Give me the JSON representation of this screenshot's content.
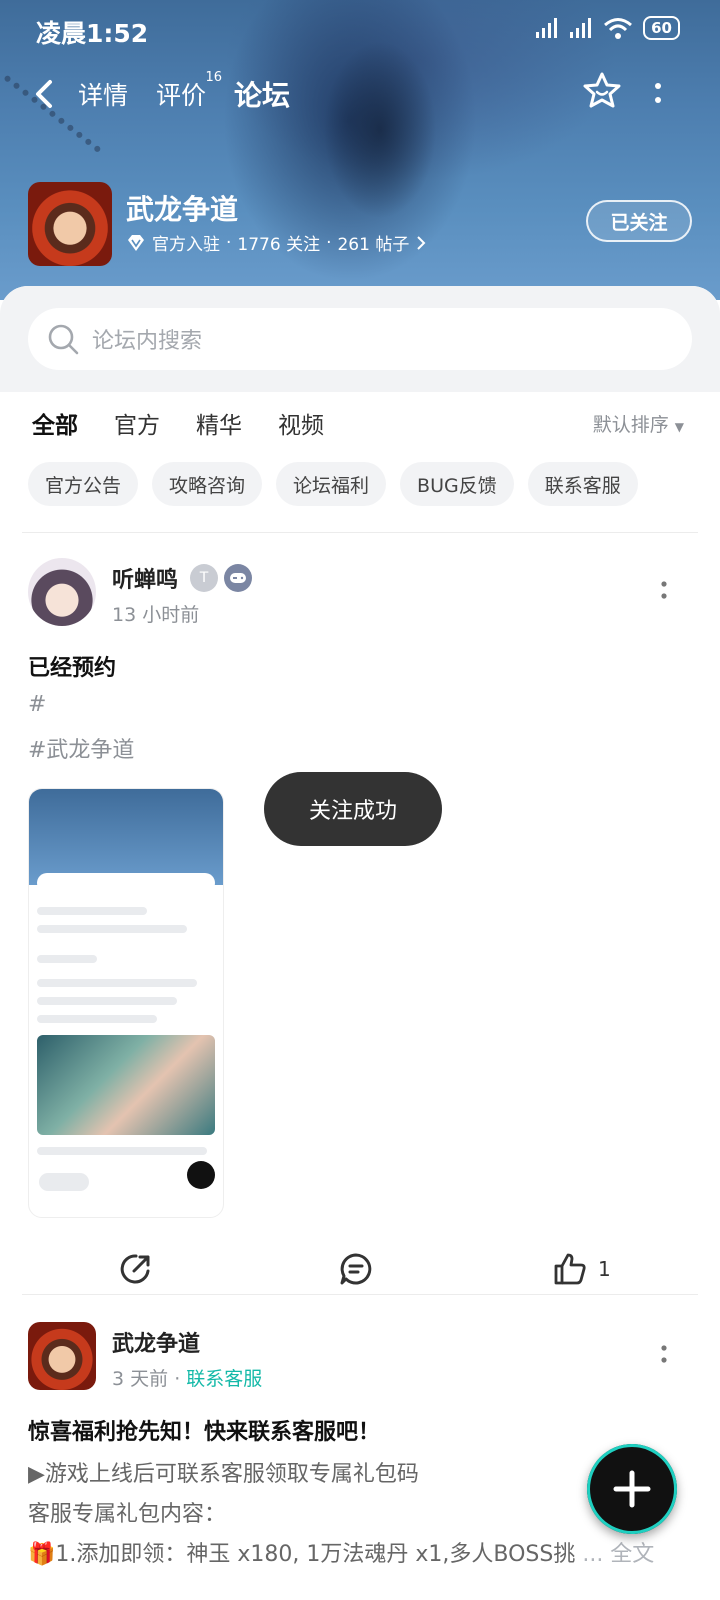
{
  "status": {
    "time": "凌晨1:52",
    "battery": "60"
  },
  "nav": {
    "tabs": [
      {
        "label": "详情"
      },
      {
        "label": "评价",
        "badge": "16"
      },
      {
        "label": "论坛"
      }
    ]
  },
  "game": {
    "name": "武龙争道",
    "verified": "官方入驻",
    "followers": "1776 关注",
    "posts": "261 帖子",
    "sep": "·",
    "follow_label": "已关注"
  },
  "search": {
    "placeholder": "论坛内搜索"
  },
  "filters": {
    "tabs": [
      "全部",
      "官方",
      "精华",
      "视频"
    ],
    "sort_label": "默认排序"
  },
  "chips": [
    "官方公告",
    "攻略咨询",
    "论坛福利",
    "BUG反馈",
    "联系客服"
  ],
  "post1": {
    "author": "听蝉鸣",
    "time": "13 小时前",
    "title": "已经预约",
    "line1": "#",
    "line2": "#武龙争道",
    "like_count": "1"
  },
  "toast": "关注成功",
  "post2": {
    "author": "武龙争道",
    "time": "3 天前",
    "tag": "联系客服",
    "title": "惊喜福利抢先知！快来联系客服吧！",
    "line1": "▶游戏上线后可联系客服领取专属礼包码",
    "line2": "客服专属礼包内容：",
    "line3": "🎁1.添加即领：神玉 x180, 1万法魂丹 x1,多人BOSS挑",
    "more": "... 全文"
  },
  "colors": {
    "accent": "#19d6c4",
    "teal_text": "#14b9a8",
    "toast_bg": "#333333"
  }
}
